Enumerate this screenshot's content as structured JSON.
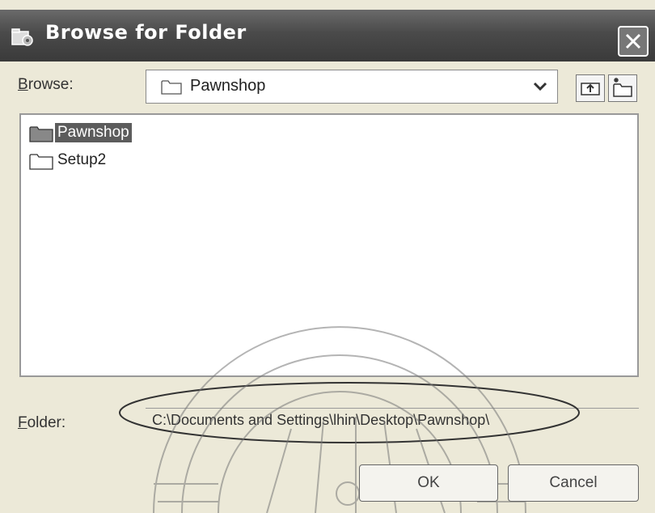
{
  "window": {
    "title": "Browse for Folder"
  },
  "browse": {
    "label_hotkey": "B",
    "label_rest": "rowse:",
    "selected": "Pawnshop"
  },
  "tree": {
    "items": [
      {
        "label": "Pawnshop",
        "selected": true
      },
      {
        "label": "Setup2",
        "selected": false
      }
    ]
  },
  "folder": {
    "label_hotkey": "F",
    "label_rest": "older:",
    "value": "C:\\Documents and Settings\\lhin\\Desktop\\Pawnshop\\"
  },
  "buttons": {
    "ok": "OK",
    "cancel": "Cancel"
  },
  "colors": {
    "titlebar": "#4a4a4a",
    "dialog_bg": "#ece9d8",
    "selection": "#5c5c5c"
  }
}
